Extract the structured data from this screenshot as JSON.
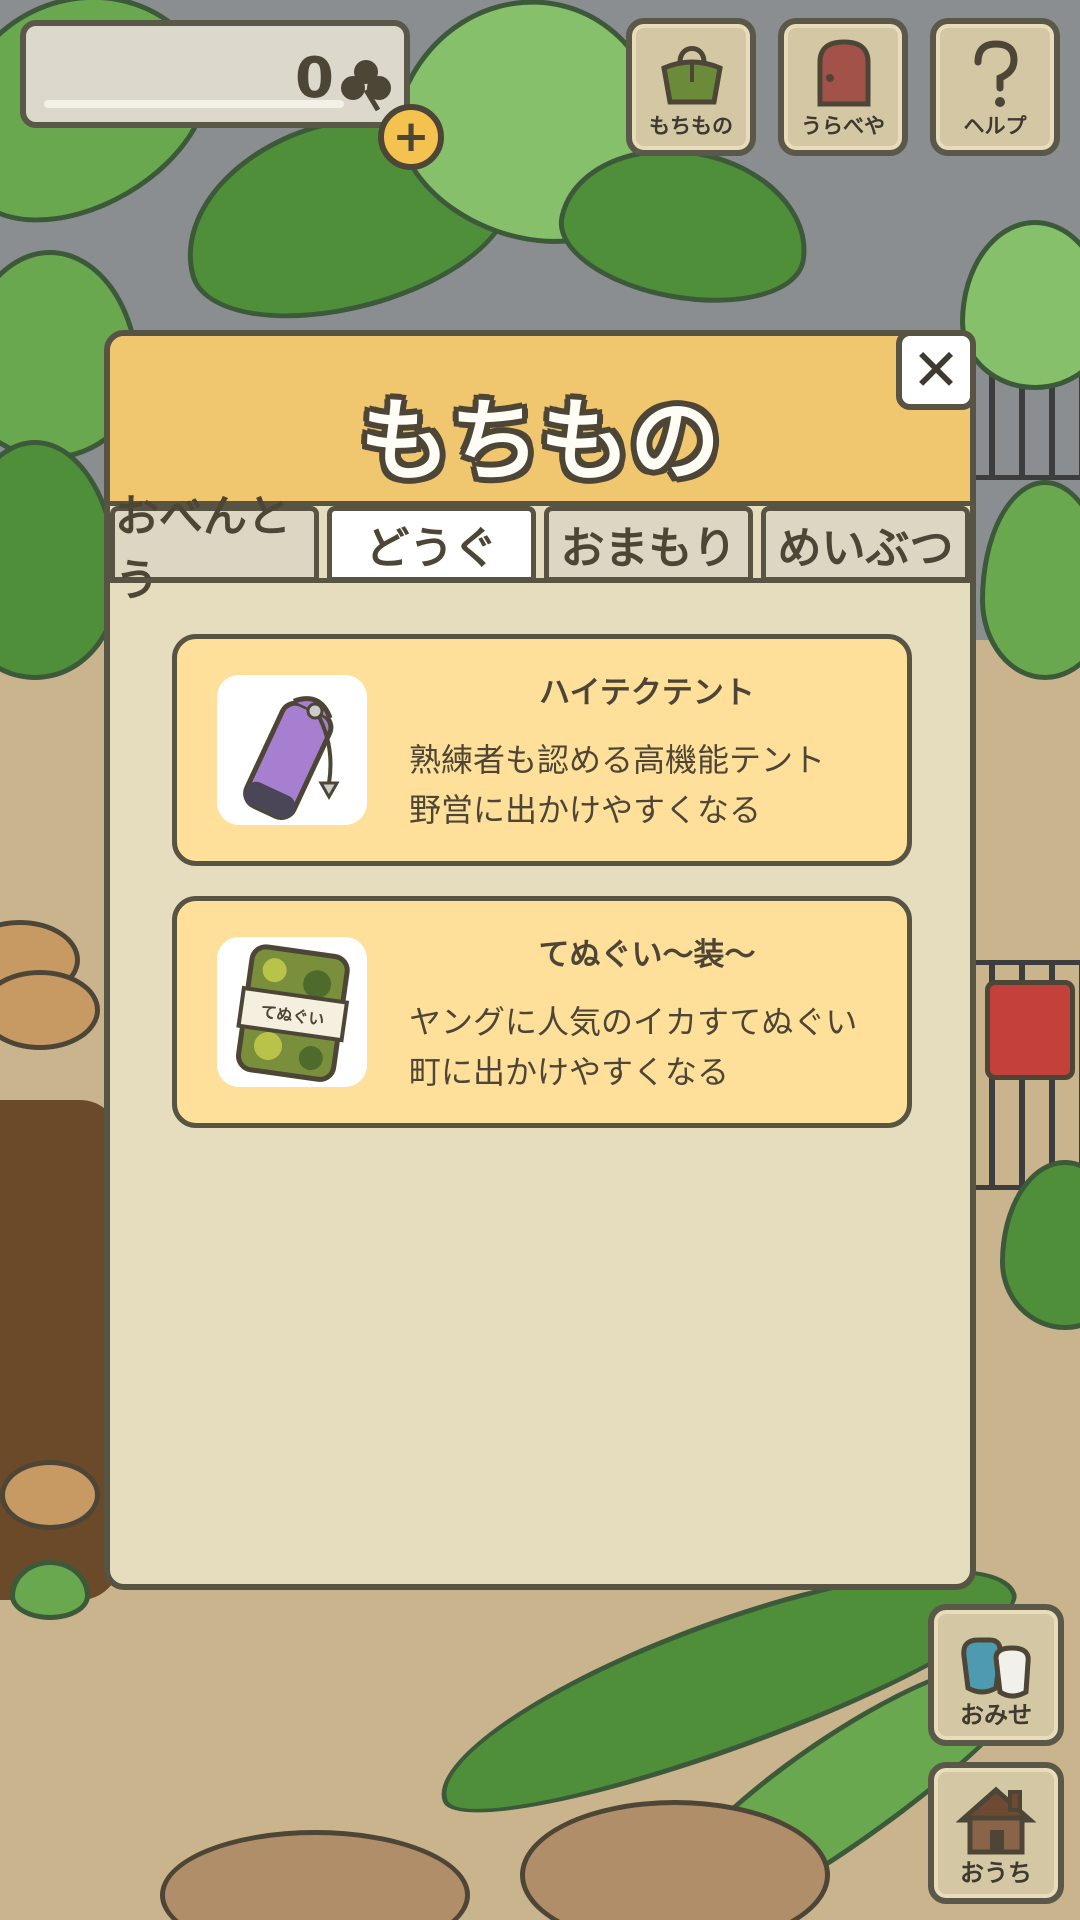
{
  "currency": {
    "clover_count": "0"
  },
  "top_menu": [
    {
      "label": "もちもの",
      "icon": "bag-icon"
    },
    {
      "label": "うらべや",
      "icon": "door-icon"
    },
    {
      "label": "ヘルプ",
      "icon": "question-icon"
    }
  ],
  "modal": {
    "title": "もちもの",
    "close_label": "✕",
    "tabs": [
      {
        "label": "おべんとう",
        "active": false
      },
      {
        "label": "どうぐ",
        "active": true
      },
      {
        "label": "おまもり",
        "active": false
      },
      {
        "label": "めいぶつ",
        "active": false
      }
    ],
    "items": [
      {
        "name": "ハイテクテント",
        "description_line1": "熟練者も認める高機能テント",
        "description_line2": "野営に出かけやすくなる",
        "icon": "purple-tent-bag-icon"
      },
      {
        "name": "てぬぐい〜装〜",
        "description_line1": "ヤングに人気のイカすてぬぐい",
        "description_line2": "町に出かけやすくなる",
        "icon": "camo-towel-icon",
        "icon_text": "てぬぐい"
      }
    ]
  },
  "side_menu": [
    {
      "label": "おみせ",
      "icon": "shop-bags-icon"
    },
    {
      "label": "おうち",
      "icon": "house-icon"
    }
  ],
  "colors": {
    "header": "#f0c66e",
    "panel": "#e6dcbe",
    "item_card": "#ffe09a",
    "outline": "#575443"
  }
}
